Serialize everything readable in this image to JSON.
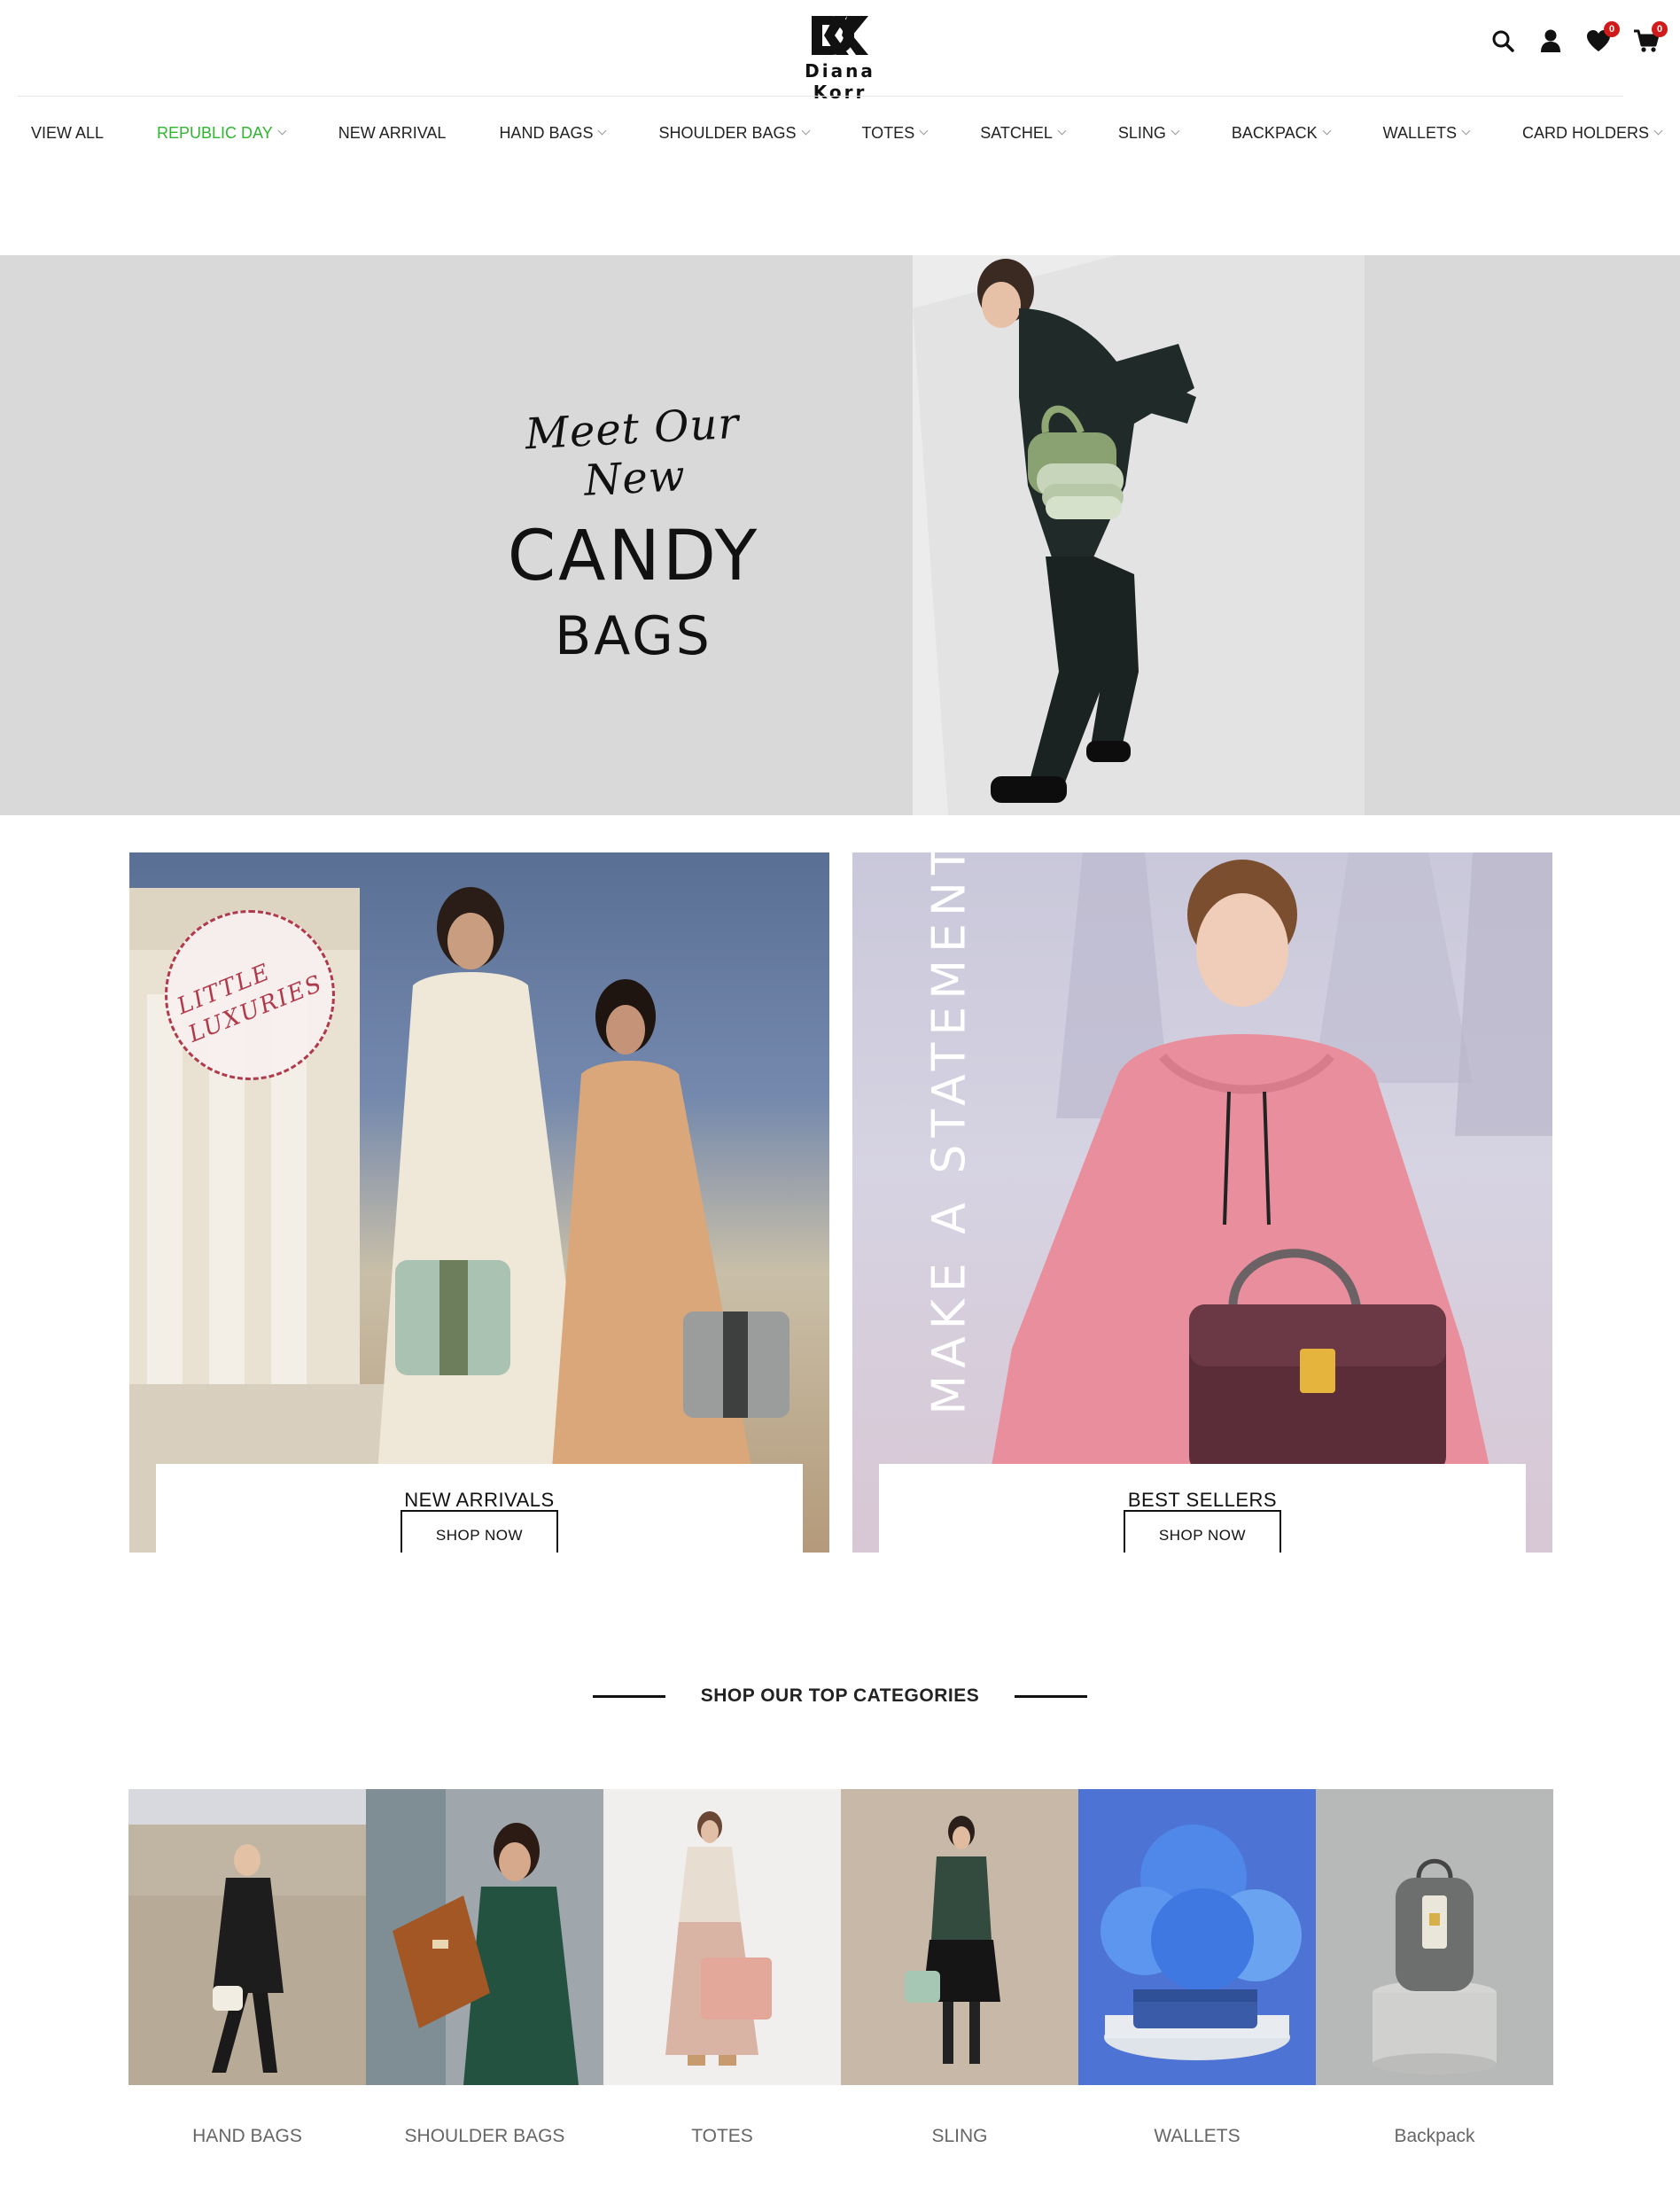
{
  "brand": {
    "mark": "DK",
    "name": "Diana Korr"
  },
  "header": {
    "icons": [
      "search-icon",
      "user-icon",
      "heart-icon",
      "cart-icon"
    ],
    "wishlist_count": "0",
    "cart_count": "0"
  },
  "nav": {
    "items": [
      {
        "label": "VIEW ALL",
        "dropdown": false
      },
      {
        "label": "REPUBLIC DAY",
        "dropdown": true,
        "active": true
      },
      {
        "label": "NEW ARRIVAL",
        "dropdown": false
      },
      {
        "label": "HAND BAGS",
        "dropdown": true
      },
      {
        "label": "SHOULDER BAGS",
        "dropdown": true
      },
      {
        "label": "TOTES",
        "dropdown": true
      },
      {
        "label": "SATCHEL",
        "dropdown": true
      },
      {
        "label": "SLING",
        "dropdown": true
      },
      {
        "label": "BACKPACK",
        "dropdown": true
      },
      {
        "label": "WALLETS",
        "dropdown": true
      },
      {
        "label": "CARD HOLDERS",
        "dropdown": true
      }
    ]
  },
  "hero": {
    "script": "Meet Our New",
    "title": "CANDY",
    "subtitle": "BAGS"
  },
  "promos": [
    {
      "overlay": "LITTLE LUXURIES",
      "label": "NEW ARRIVALS",
      "button": "SHOP NOW"
    },
    {
      "overlay": "MAKE A STATEMENT",
      "label": "BEST SELLERS",
      "button": "SHOP NOW"
    }
  ],
  "categories_section": {
    "heading": "SHOP OUR TOP CATEGORIES",
    "items": [
      {
        "label": "HAND BAGS"
      },
      {
        "label": "SHOULDER BAGS"
      },
      {
        "label": "TOTES"
      },
      {
        "label": "SLING"
      },
      {
        "label": "WALLETS"
      },
      {
        "label": "Backpack"
      }
    ]
  },
  "colors": {
    "accent_green": "#2fb62f",
    "badge_red": "#d11b1b",
    "hero_bg": "#d9d9d9",
    "text_dark": "#111111"
  }
}
